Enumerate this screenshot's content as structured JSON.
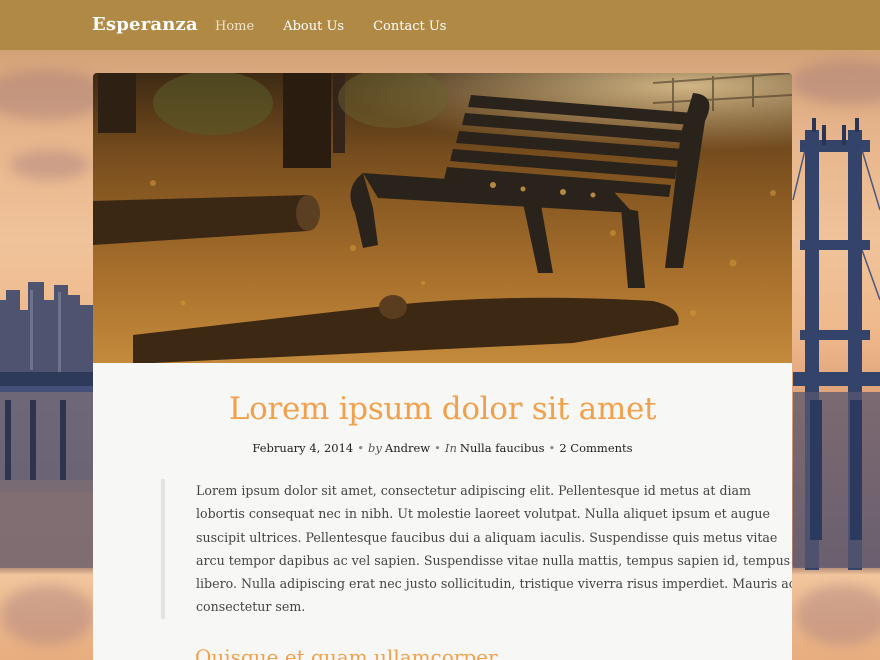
{
  "site": {
    "title": "Esperanza"
  },
  "nav": {
    "items": [
      {
        "label": "Home",
        "current": true
      },
      {
        "label": "About Us",
        "current": false
      },
      {
        "label": "Contact Us",
        "current": false
      }
    ]
  },
  "post": {
    "title": "Lorem ipsum dolor sit amet",
    "meta": {
      "date": "February 4, 2014",
      "by_label": "by",
      "author": "Andrew",
      "in_label": "In",
      "category": "Nulla faucibus",
      "comments": "2 Comments"
    },
    "quote": "Lorem ipsum dolor sit amet, consectetur adipiscing elit. Pellentesque id metus at diam lobortis consequat nec in nibh. Ut molestie laoreet volutpat. Nulla aliquet ipsum et augue suscipit ultrices. Pellentesque faucibus dui a aliquam iaculis. Suspendisse quis metus vitae arcu tempor dapibus ac vel sapien. Suspendisse vitae nulla mattis, tempus sapien id, tempus libero. Nulla adipiscing erat nec justo sollicitudin, tristique viverra risus imperdiet. Mauris ac consectetur sem.",
    "subheading": "Quisque et quam ullamcorper"
  },
  "colors": {
    "header": "#b08a45",
    "accent": "#f1a04b",
    "card": "#f7f7f6",
    "text": "#444444"
  }
}
